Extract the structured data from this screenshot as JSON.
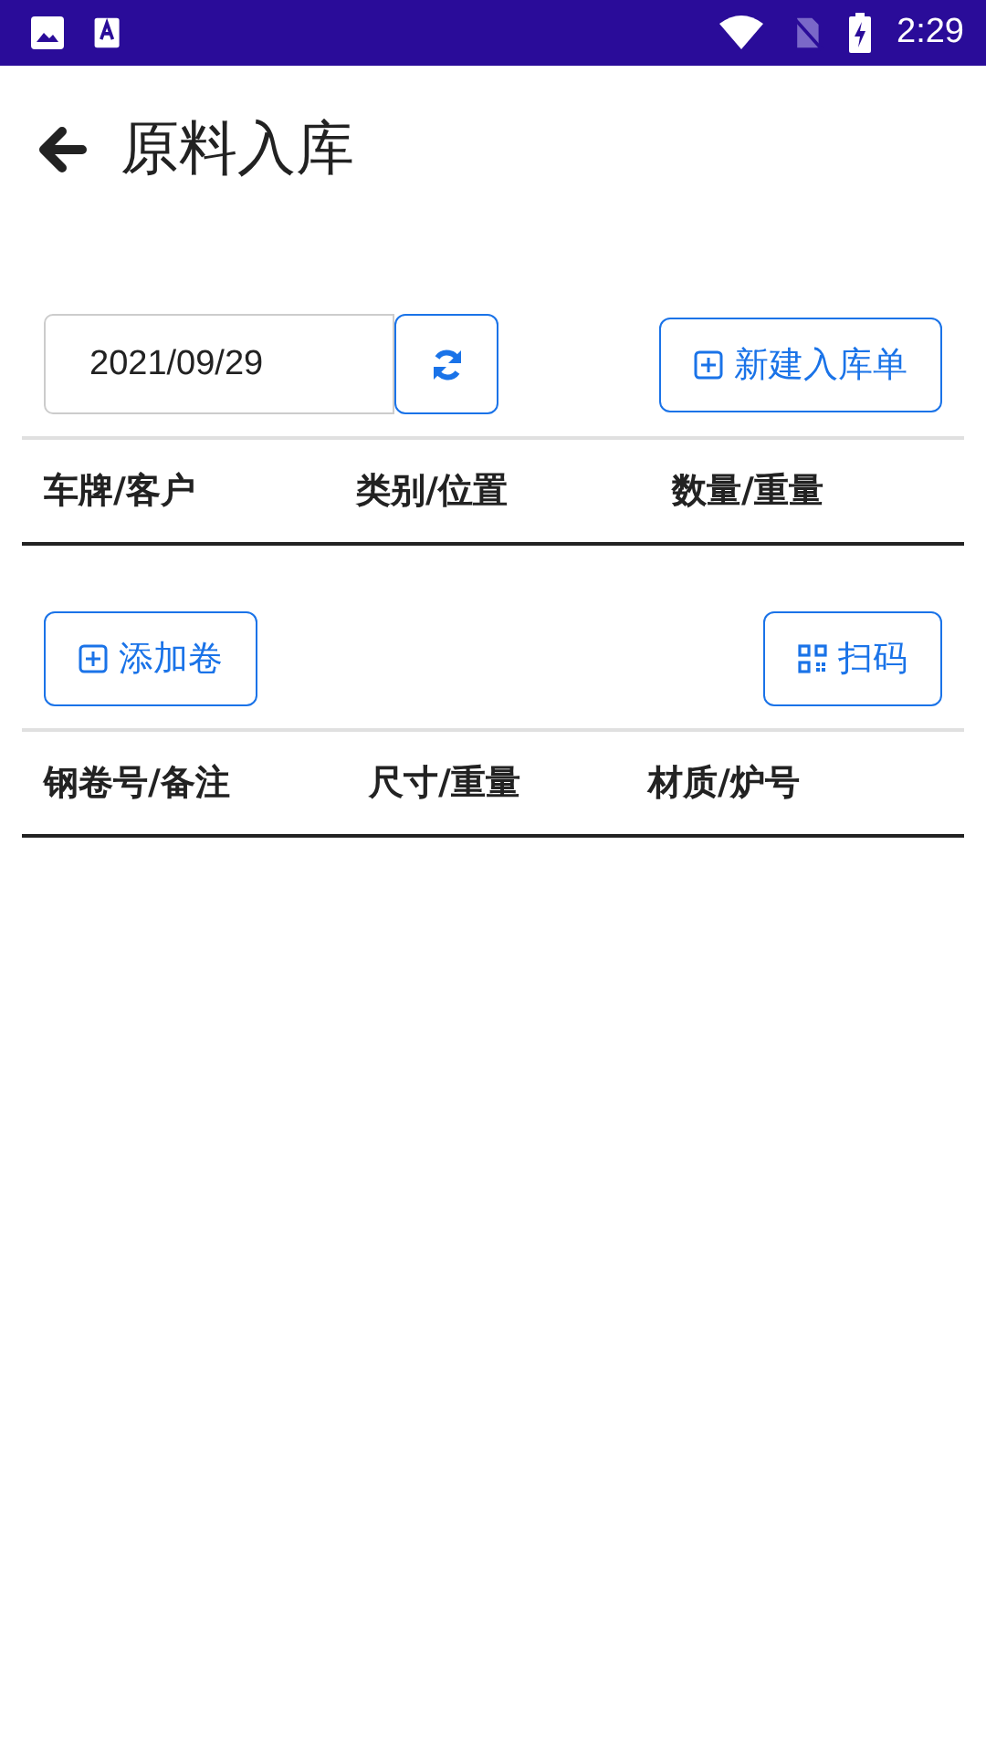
{
  "status_bar": {
    "time": "2:29"
  },
  "header": {
    "title": "原料入库"
  },
  "toolbar": {
    "date": "2021/09/29",
    "new_button": "新建入库单"
  },
  "orders_table": {
    "columns": [
      "车牌/客户",
      "类别/位置",
      "数量/重量"
    ]
  },
  "coil_toolbar": {
    "add_button": "添加卷",
    "scan_button": "扫码"
  },
  "coils_table": {
    "columns": [
      "钢卷号/备注",
      "尺寸/重量",
      "材质/炉号"
    ]
  }
}
